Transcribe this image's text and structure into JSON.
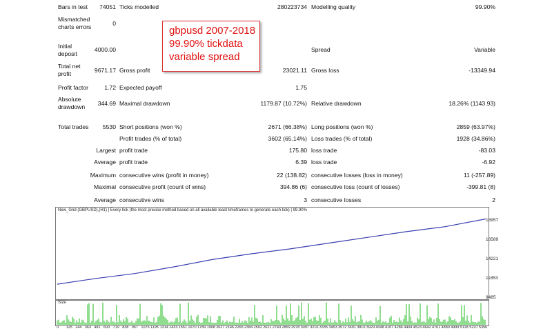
{
  "rows": {
    "bars": {
      "label": "Bars in test",
      "value": "74051",
      "label2": "Ticks modelled",
      "value2": "280223734",
      "label3": "Modelling quality",
      "value3": "99.90%"
    },
    "mismatch": {
      "label_line1": "Mismatched",
      "label_line2": "charts errors",
      "value": "0"
    },
    "initial": {
      "label_line1": "Initial",
      "label_line2": "deposit",
      "value": "4000.00",
      "label3": "Spread",
      "value3": "Variable"
    },
    "netprofit": {
      "label_line1": "Total net",
      "label_line2": "profit",
      "value": "9671.17",
      "label2": "Gross profit",
      "value2": "23021.11",
      "label3": "Gross loss",
      "value3": "-13349.94"
    },
    "pf": {
      "label": "Profit factor",
      "value": "1.72",
      "label2": "Expected payoff",
      "value2": "1.75"
    },
    "dd": {
      "label_line1": "Absolute",
      "label_line2": "drawdown",
      "value": "344.69",
      "label2": "Maximal drawdown",
      "value2": "1179.87 (10.72%)",
      "label3": "Relative drawdown",
      "value3": "18.26% (1143.93)"
    },
    "trades": {
      "label": "Total trades",
      "value": "5530",
      "label2": "Short positions (won %)",
      "value2": "2671 (66.38%)",
      "label3": "Long positions (won %)",
      "value3": "2859 (63.97%)"
    },
    "pt": {
      "label2": "Profit trades (% of total)",
      "value2": "3602 (65.14%)",
      "label3": "Loss trades (% of total)",
      "value3": "1928 (34.86%)"
    },
    "largest": {
      "label": "Largest",
      "label2": "profit trade",
      "value2": "175.80",
      "label3": "loss trade",
      "value3": "-83.03"
    },
    "average": {
      "label": "Average",
      "label2": "profit trade",
      "value2": "6.39",
      "label3": "loss trade",
      "value3": "-6.92"
    },
    "maximum": {
      "label": "Maximum",
      "label2": "consecutive wins (profit in money)",
      "value2": "22 (138.82)",
      "label3": "consecutive losses (loss in money)",
      "value3": "11 (-257.89)"
    },
    "maximal": {
      "label": "Maximal",
      "label2": "consecutive profit (count of wins)",
      "value2": "394.86 (6)",
      "label3": "consecutive loss (count of losses)",
      "value3": "-399.81 (8)"
    },
    "average2": {
      "label": "Average",
      "label2": "consecutive wins",
      "value2": "3",
      "label3": "consecutive losses",
      "value3": "2"
    }
  },
  "callout": {
    "line1": "gbpusd 2007-2018",
    "line2": "99.90% tickdata",
    "line3": "variable spread"
  },
  "chart": {
    "header": "New_Grid (GBPUSD),(H1) | Every tick (the most precise method based on all available least timeframes to generate each tick) | 99.90%",
    "size_label": "Size",
    "line_color": "#3a3fb0",
    "vol_color": "#22bb22"
  },
  "chart_data": {
    "type": "line",
    "yticks": [
      "18957",
      "16589",
      "14221",
      "11853",
      "9485"
    ],
    "xticks": [
      "0",
      "125",
      "244",
      "363",
      "481",
      "600",
      "719",
      "838",
      "957",
      "1076",
      "1195",
      "1314",
      "1433",
      "1551",
      "1670",
      "1789",
      "1908",
      "2027",
      "2146",
      "2265",
      "2384",
      "2502",
      "2621",
      "2740",
      "2859",
      "2978",
      "3097",
      "3216",
      "3335",
      "3453",
      "3572",
      "3691",
      "3810",
      "3929",
      "4048",
      "4167",
      "4286",
      "4404",
      "4523",
      "4642",
      "4761",
      "4880",
      "4999",
      "5118",
      "5237",
      "5356"
    ],
    "x": [
      0,
      500,
      1000,
      1500,
      2000,
      2500,
      3000,
      3500,
      4000,
      4500,
      5000,
      5530
    ],
    "y": [
      4000,
      4700,
      5300,
      6100,
      7000,
      7700,
      8300,
      9000,
      9700,
      10400,
      11000,
      11950
    ],
    "ylim": [
      2500,
      13000
    ]
  }
}
